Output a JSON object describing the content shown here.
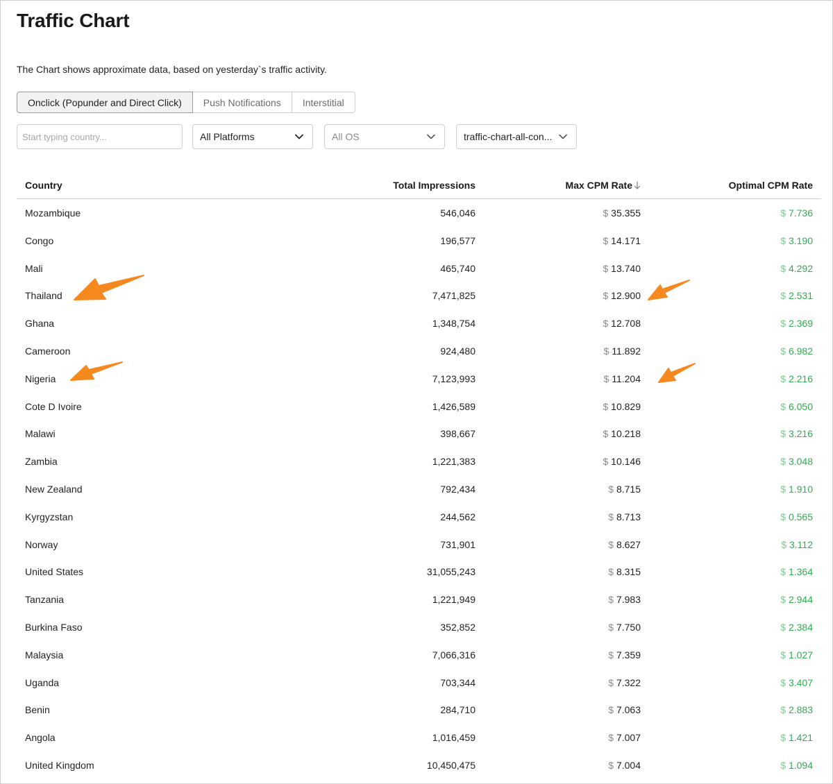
{
  "page": {
    "title": "Traffic Chart",
    "subtitle": "The Chart shows approximate data, based on yesterday`s traffic activity."
  },
  "tabs": [
    {
      "label": "Onclick (Popunder and Direct Click)",
      "active": true
    },
    {
      "label": "Push Notifications",
      "active": false
    },
    {
      "label": "Interstitial",
      "active": false
    }
  ],
  "filters": {
    "search_placeholder": "Start typing country...",
    "platform": "All Platforms",
    "os": "All OS",
    "list": "traffic-chart-all-con..."
  },
  "table": {
    "headers": {
      "country": "Country",
      "impressions": "Total Impressions",
      "max_cpm": "Max CPM Rate",
      "optimal_cpm": "Optimal CPM Rate"
    },
    "sort": {
      "column": "max_cpm",
      "direction": "desc",
      "icon": "arrow-down-icon"
    },
    "currency_symbol": "$",
    "rows": [
      {
        "country": "Mozambique",
        "impressions": "546,046",
        "max_cpm": "35.355",
        "optimal_cpm": "7.736"
      },
      {
        "country": "Congo",
        "impressions": "196,577",
        "max_cpm": "14.171",
        "optimal_cpm": "3.190"
      },
      {
        "country": "Mali",
        "impressions": "465,740",
        "max_cpm": "13.740",
        "optimal_cpm": "4.292"
      },
      {
        "country": "Thailand",
        "impressions": "7,471,825",
        "max_cpm": "12.900",
        "optimal_cpm": "2.531"
      },
      {
        "country": "Ghana",
        "impressions": "1,348,754",
        "max_cpm": "12.708",
        "optimal_cpm": "2.369"
      },
      {
        "country": "Cameroon",
        "impressions": "924,480",
        "max_cpm": "11.892",
        "optimal_cpm": "6.982"
      },
      {
        "country": "Nigeria",
        "impressions": "7,123,993",
        "max_cpm": "11.204",
        "optimal_cpm": "2.216"
      },
      {
        "country": "Cote D Ivoire",
        "impressions": "1,426,589",
        "max_cpm": "10.829",
        "optimal_cpm": "6.050"
      },
      {
        "country": "Malawi",
        "impressions": "398,667",
        "max_cpm": "10.218",
        "optimal_cpm": "3.216"
      },
      {
        "country": "Zambia",
        "impressions": "1,221,383",
        "max_cpm": "10.146",
        "optimal_cpm": "3.048"
      },
      {
        "country": "New Zealand",
        "impressions": "792,434",
        "max_cpm": "8.715",
        "optimal_cpm": "1.910"
      },
      {
        "country": "Kyrgyzstan",
        "impressions": "244,562",
        "max_cpm": "8.713",
        "optimal_cpm": "0.565"
      },
      {
        "country": "Norway",
        "impressions": "731,901",
        "max_cpm": "8.627",
        "optimal_cpm": "3.112"
      },
      {
        "country": "United States",
        "impressions": "31,055,243",
        "max_cpm": "8.315",
        "optimal_cpm": "1.364"
      },
      {
        "country": "Tanzania",
        "impressions": "1,221,949",
        "max_cpm": "7.983",
        "optimal_cpm": "2.944"
      },
      {
        "country": "Burkina Faso",
        "impressions": "352,852",
        "max_cpm": "7.750",
        "optimal_cpm": "2.384"
      },
      {
        "country": "Malaysia",
        "impressions": "7,066,316",
        "max_cpm": "7.359",
        "optimal_cpm": "1.027"
      },
      {
        "country": "Uganda",
        "impressions": "703,344",
        "max_cpm": "7.322",
        "optimal_cpm": "3.407"
      },
      {
        "country": "Benin",
        "impressions": "284,710",
        "max_cpm": "7.063",
        "optimal_cpm": "2.883"
      },
      {
        "country": "Angola",
        "impressions": "1,016,459",
        "max_cpm": "7.007",
        "optimal_cpm": "1.421"
      },
      {
        "country": "United Kingdom",
        "impressions": "10,450,475",
        "max_cpm": "7.004",
        "optimal_cpm": "1.094"
      }
    ]
  },
  "annotations": {
    "color": "#F5891E",
    "arrows": [
      {
        "name": "annotation-arrow-thailand"
      },
      {
        "name": "annotation-arrow-thailand-cpm"
      },
      {
        "name": "annotation-arrow-nigeria"
      },
      {
        "name": "annotation-arrow-nigeria-cpm"
      }
    ]
  },
  "colors": {
    "optimal_green": "#2FAE4F",
    "border": "#CFCFCF",
    "active_tab_bg": "#F2F2F2"
  }
}
